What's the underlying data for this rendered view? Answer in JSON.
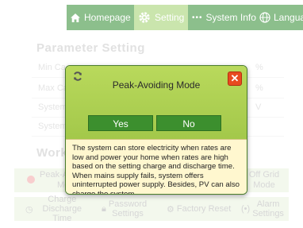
{
  "nav": {
    "homepage": "Homepage",
    "setting": "Setting",
    "system_info": "System Info",
    "language": "Language"
  },
  "page": {
    "parameter_title": "Parameter Setting",
    "rows": [
      {
        "label": "Min Ca",
        "unit": "%"
      },
      {
        "label": "Max Ca",
        "unit": "%"
      },
      {
        "label": "System",
        "unit": "V"
      },
      {
        "label": "System",
        "unit": ""
      }
    ],
    "work_title": "Work",
    "modes": [
      {
        "line1": "Peak-A",
        "line2": "Mo"
      },
      {
        "line1": "Off Grid",
        "line2": "Mode"
      }
    ],
    "bottom": [
      {
        "line1": "Charge",
        "line2": "Discharge Time"
      },
      {
        "line1": "Password",
        "line2": "Settings"
      },
      {
        "line1": "Factory Reset",
        "line2": ""
      },
      {
        "line1": "Alarm",
        "line2": "Settings"
      }
    ]
  },
  "modal": {
    "title": "Peak-Avoiding Mode",
    "yes": "Yes",
    "no": "No",
    "close": "✕",
    "description": "The system can store electricity when rates are low and power your home when rates are high based on the setting charge and discharge time. When mains supply fails, system offers uninterrupted power supply. Besides, PV can also charge the system."
  },
  "colors": {
    "nav_green": "#2f8a2f",
    "nav_active": "#9ecf6a",
    "modal_head": "#b2d455",
    "button_green": "#3c8f2e",
    "close_red": "#e84a1f",
    "description_bg": "#fff7cf"
  },
  "icons": {
    "homepage": "home-icon",
    "setting": "gear-icon",
    "system_info": "dots-icon",
    "language": "globe-icon",
    "modal": "refresh-icon",
    "close": "close-icon"
  }
}
